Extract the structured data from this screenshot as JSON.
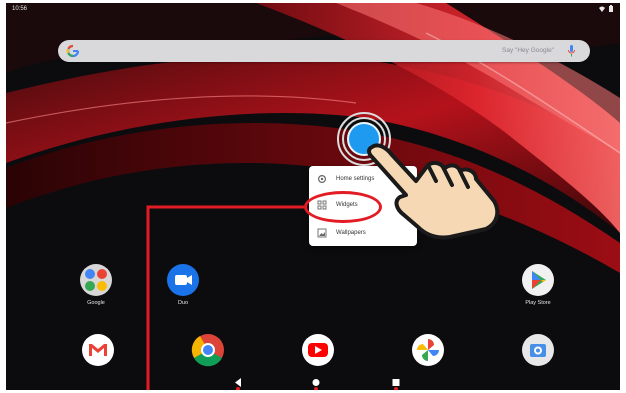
{
  "status_bar": {
    "time": "10:56",
    "icons": [
      "wifi-icon",
      "battery-icon"
    ]
  },
  "search": {
    "logo": "google-g-icon",
    "hint": "Say \"Hey Google\"",
    "mic": "mic-icon"
  },
  "context_menu": {
    "items": [
      {
        "label": "Home settings",
        "icon": "settings-icon"
      },
      {
        "label": "Widgets",
        "icon": "widgets-icon",
        "highlighted": true
      },
      {
        "label": "Wallpapers",
        "icon": "wallpaper-icon"
      }
    ]
  },
  "apps": {
    "row1": [
      {
        "label": "Google",
        "icon": "google-folder-icon"
      },
      {
        "label": "Duo",
        "icon": "duo-icon"
      },
      {
        "label": "Play Store",
        "icon": "play-store-icon"
      }
    ],
    "dock": [
      {
        "label": "",
        "icon": "gmail-icon"
      },
      {
        "label": "",
        "icon": "chrome-icon"
      },
      {
        "label": "",
        "icon": "youtube-icon"
      },
      {
        "label": "",
        "icon": "photos-icon"
      },
      {
        "label": "",
        "icon": "camera-icon"
      }
    ]
  },
  "navigation": {
    "buttons": [
      "back-icon",
      "home-icon",
      "recents-icon"
    ]
  },
  "annotation": {
    "color": "#e21b24",
    "gesture": "tap-and-hold-hand-icon"
  },
  "colors": {
    "accent_red": "#e21b24",
    "touch_blue": "#1e9bf0",
    "wallpaper_dark": "#0c0c0f"
  }
}
